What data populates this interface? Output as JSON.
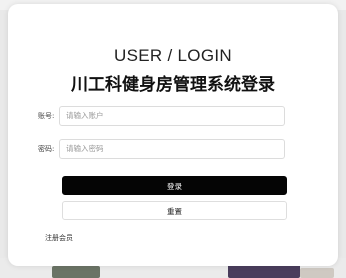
{
  "header": {
    "title_en": "USER / LOGIN",
    "title_cn": "川工科健身房管理系统登录"
  },
  "form": {
    "account_label": "账号:",
    "account_placeholder": "请输入账户",
    "password_label": "密码:",
    "password_placeholder": "请输入密码"
  },
  "buttons": {
    "login_label": "登录",
    "reset_label": "重置"
  },
  "links": {
    "register_label": "注册会员"
  },
  "colors": {
    "login_button": "#050505",
    "card_background": "#ffffff",
    "page_background": "#e9e9e9"
  }
}
